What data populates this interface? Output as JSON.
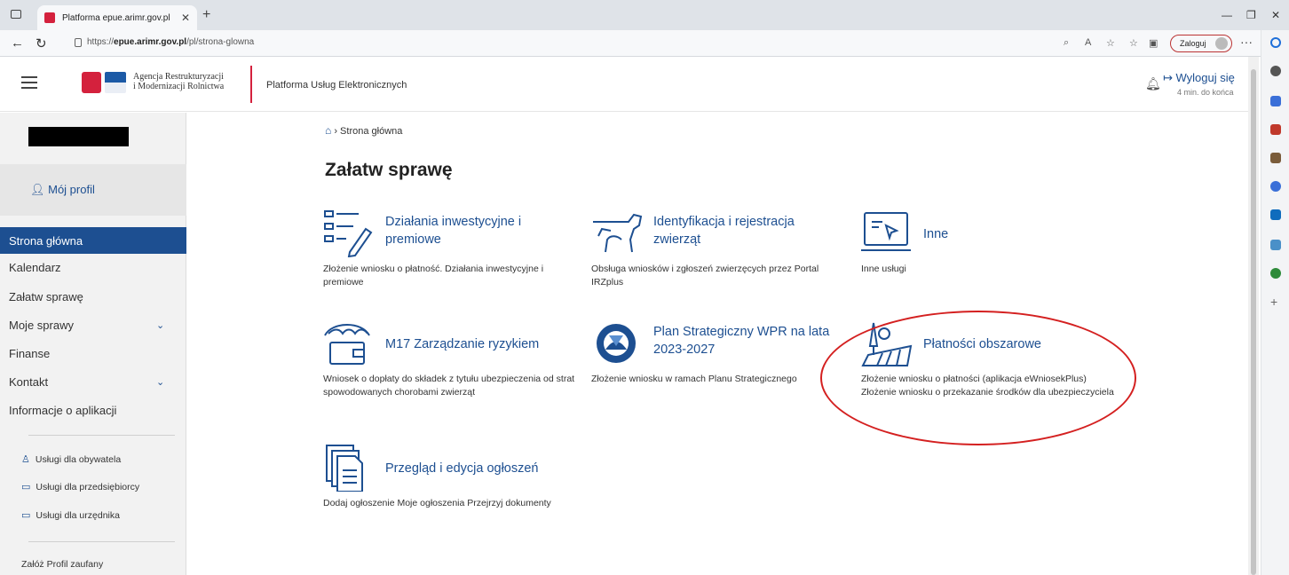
{
  "browser": {
    "tab_title": "Platforma epue.arimr.gov.pl",
    "url_prefix": "https://",
    "url_host": "epue.arimr.gov.pl",
    "url_path": "/pl/strona-glowna",
    "login_button": "Zaloguj"
  },
  "header": {
    "agency_line1": "Agencja Restrukturyzacji",
    "agency_line2": "i Modernizacji Rolnictwa",
    "platform_name": "Platforma Usług Elektronicznych",
    "logout_label": "Wyloguj się",
    "session_timer": "4 min. do końca"
  },
  "sidebar": {
    "profile_label": "Mój profil",
    "nav": [
      {
        "label": "Strona główna",
        "active": true
      },
      {
        "label": "Kalendarz"
      },
      {
        "label": "Załatw sprawę"
      },
      {
        "label": "Moje sprawy",
        "expandable": true
      },
      {
        "label": "Finanse"
      },
      {
        "label": "Kontakt",
        "expandable": true
      },
      {
        "label": "Informacje o aplikacji"
      }
    ],
    "services": [
      {
        "label": "Usługi dla obywatela",
        "icon": "person-icon"
      },
      {
        "label": "Usługi dla przedsiębiorcy",
        "icon": "briefcase-icon"
      },
      {
        "label": "Usługi dla urzędnika",
        "icon": "monitor-icon"
      }
    ],
    "trusted_profile": "Załóż Profil zaufany"
  },
  "main": {
    "breadcrumb": "Strona główna",
    "title": "Załatw sprawę",
    "cards": [
      {
        "title": "Działania inwestycyjne i premiowe",
        "desc": "Złożenie wniosku o płatność. Działania inwestycyjne i premiowe",
        "icon": "form-pen-icon"
      },
      {
        "title": "Identyfikacja i rejestracja zwierząt",
        "desc": "Obsługa wniosków i zgłoszeń zwierzęcych przez Portal IRZplus",
        "icon": "cow-icon"
      },
      {
        "title": "Inne",
        "desc": "Inne usługi",
        "icon": "laptop-icon"
      },
      {
        "title": "M17 Zarządzanie ryzykiem",
        "desc": "Wniosek o dopłaty do składek z tytułu ubezpieczenia od strat spowodowanych chorobami zwierząt",
        "icon": "umbrella-wallet-icon"
      },
      {
        "title": "Plan Strategiczny WPR na lata 2023-2027",
        "desc": "Złożenie wniosku w ramach Planu Strategicznego",
        "icon": "eu-stars-icon"
      },
      {
        "title": "Płatności obszarowe",
        "desc": "Złożenie wniosku o płatności (aplikacja eWniosekPlus) Złożenie wniosku o przekazanie środków dla ubezpieczyciela",
        "icon": "field-tree-icon"
      },
      {
        "title": "Przegląd i edycja ogłoszeń",
        "desc": "Dodaj ogłoszenie Moje ogłoszenia Przejrzyj dokumenty",
        "icon": "documents-icon"
      }
    ]
  },
  "colors": {
    "primary": "#1d4f91",
    "brand_red": "#d4213d",
    "highlight_circle": "#d42020"
  }
}
